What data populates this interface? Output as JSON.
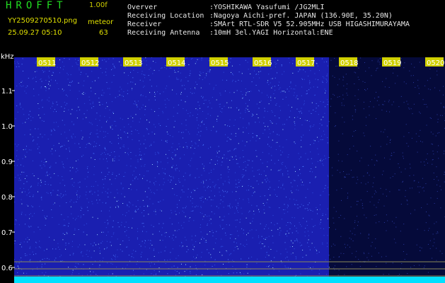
{
  "header": {
    "app_title": "HROFFT",
    "version": "1.00f",
    "filename": "YY2509270510.png",
    "datetime": "25.09.27 05:10",
    "meteor_label": "meteor",
    "meteor_count": "63",
    "info": [
      {
        "label": "Overver",
        "value": ":YOSHIKAWA Yasufumi /JG2MLI"
      },
      {
        "label": "Receiving Location",
        "value": ":Nagoya Aichi-pref. JAPAN (136.90E, 35.20N)"
      },
      {
        "label": "Receiver",
        "value": ":SMArt RTL-SDR V5 52.905MHz USB HIGASHIMURAYAMA"
      },
      {
        "label": "Receiving Antenna",
        "value": ":10mH 3el.YAGI Horizontal:ENE"
      }
    ]
  },
  "spectrogram": {
    "y_unit": "kHz",
    "y_ticks": [
      "1.1",
      "1.0",
      "0.9",
      "0.8",
      "0.7",
      "0.6"
    ],
    "time_labels": [
      "0511",
      "0512",
      "0513",
      "0514",
      "0515",
      "0516",
      "0517",
      "0518",
      "0519",
      "0520"
    ],
    "colors": {
      "active_bg": "#1a1fb0",
      "inactive_bg": "#050a3a",
      "noise": "#4d7bff",
      "label_bg": "#d0d000",
      "label_text": "#ffffff",
      "baseline": "#00e0ff",
      "axis_text": "#ffffff"
    }
  }
}
